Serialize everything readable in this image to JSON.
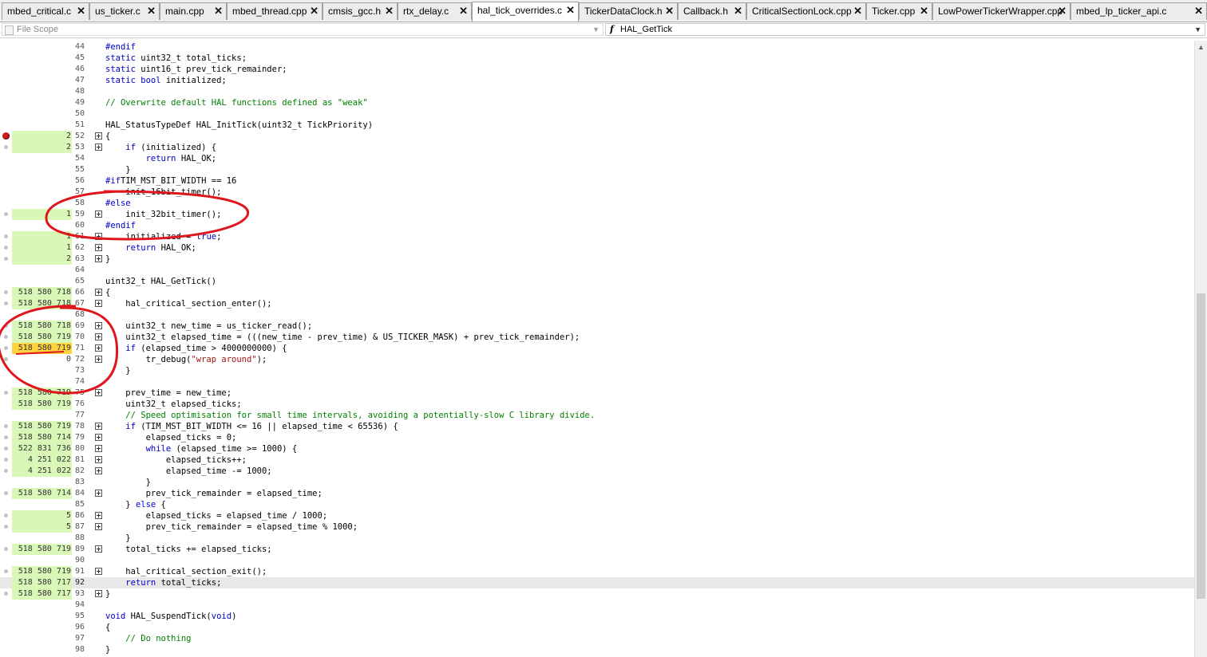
{
  "tabs": [
    {
      "label": "mbed_critical.c",
      "active": false
    },
    {
      "label": "us_ticker.c",
      "active": false
    },
    {
      "label": "main.cpp",
      "active": false
    },
    {
      "label": "mbed_thread.cpp",
      "active": false
    },
    {
      "label": "cmsis_gcc.h",
      "active": false
    },
    {
      "label": "rtx_delay.c",
      "active": false
    },
    {
      "label": "hal_tick_overrides.c",
      "active": true
    },
    {
      "label": "TickerDataClock.h",
      "active": false
    },
    {
      "label": "Callback.h",
      "active": false
    },
    {
      "label": "CriticalSectionLock.cpp",
      "active": false
    },
    {
      "label": "Ticker.cpp",
      "active": false
    },
    {
      "label": "LowPowerTickerWrapper.cpp",
      "active": false
    },
    {
      "label": "mbed_lp_ticker_api.c",
      "active": false
    }
  ],
  "tab_close_glyph": "✕",
  "navigation": {
    "scope_label": "File Scope",
    "function_icon": "f",
    "function_label": "HAL_GetTick",
    "dropdown_glyph": "▼"
  },
  "colors": {
    "coverage_hit": "#d9f7b7",
    "coverage_hot": "#ffd23f",
    "breakpoint": "#d21e1e",
    "annotation": "#e0161e",
    "keyword": "#0000cc",
    "comment": "#008000"
  },
  "lines": [
    {
      "n": "44",
      "hits": "",
      "cov": false,
      "bp": "",
      "fold": false,
      "code": [
        [
          "pp",
          "#endif"
        ]
      ]
    },
    {
      "n": "45",
      "hits": "",
      "cov": false,
      "bp": "",
      "fold": false,
      "code": [
        [
          "kw",
          "static"
        ],
        [
          "",
          "uint32_t total_ticks;"
        ]
      ]
    },
    {
      "n": "46",
      "hits": "",
      "cov": false,
      "bp": "",
      "fold": false,
      "code": [
        [
          "kw",
          "static"
        ],
        [
          "",
          "uint16_t prev_tick_remainder;"
        ]
      ]
    },
    {
      "n": "47",
      "hits": "",
      "cov": false,
      "bp": "",
      "fold": false,
      "code": [
        [
          "kw",
          "static"
        ],
        [
          "",
          ""
        ],
        [
          "kw",
          "bool"
        ],
        [
          "",
          "initialized;"
        ]
      ]
    },
    {
      "n": "48",
      "hits": "",
      "cov": false,
      "bp": "",
      "fold": false,
      "code": []
    },
    {
      "n": "49",
      "hits": "",
      "cov": false,
      "bp": "",
      "fold": false,
      "code": [
        [
          "cm",
          "// Overwrite default HAL functions defined as \"weak\""
        ]
      ]
    },
    {
      "n": "50",
      "hits": "",
      "cov": false,
      "bp": "",
      "fold": false,
      "code": []
    },
    {
      "n": "51",
      "hits": "",
      "cov": false,
      "bp": "",
      "fold": false,
      "code": [
        [
          "",
          "HAL_StatusTypeDef HAL_InitTick(uint32_t TickPriority)"
        ]
      ]
    },
    {
      "n": "52",
      "hits": "2",
      "cov": true,
      "bp": "red",
      "fold": true,
      "code": [
        [
          "",
          "{"
        ]
      ]
    },
    {
      "n": "53",
      "hits": "2",
      "cov": true,
      "bp": "dot",
      "fold": true,
      "code": [
        [
          "",
          "    "
        ],
        [
          "kw",
          "if"
        ],
        [
          "",
          "(initialized) {"
        ]
      ]
    },
    {
      "n": "54",
      "hits": "",
      "cov": false,
      "bp": "",
      "fold": false,
      "code": [
        [
          "",
          "        "
        ],
        [
          "kw",
          "return"
        ],
        [
          "",
          "HAL_OK;"
        ]
      ]
    },
    {
      "n": "55",
      "hits": "",
      "cov": false,
      "bp": "",
      "fold": false,
      "code": [
        [
          "",
          "    }"
        ]
      ]
    },
    {
      "n": "56",
      "hits": "",
      "cov": false,
      "bp": "",
      "fold": false,
      "code": [
        [
          "pp",
          "#if"
        ],
        [
          "",
          "TIM_MST_BIT_WIDTH == 16"
        ]
      ]
    },
    {
      "n": "57",
      "hits": "",
      "cov": false,
      "bp": "",
      "fold": false,
      "code": [
        [
          "",
          "    init_16bit_timer();"
        ]
      ]
    },
    {
      "n": "58",
      "hits": "",
      "cov": false,
      "bp": "",
      "fold": false,
      "code": [
        [
          "pp",
          "#else"
        ]
      ]
    },
    {
      "n": "59",
      "hits": "1",
      "cov": true,
      "bp": "dot",
      "fold": true,
      "code": [
        [
          "",
          "    init_32bit_timer();"
        ]
      ]
    },
    {
      "n": "60",
      "hits": "",
      "cov": false,
      "bp": "",
      "fold": false,
      "code": [
        [
          "pp",
          "#endif"
        ]
      ]
    },
    {
      "n": "61",
      "hits": "1",
      "cov": true,
      "bp": "dot",
      "fold": true,
      "code": [
        [
          "",
          "    initialized = "
        ],
        [
          "kw",
          "true"
        ],
        [
          "",
          ";"
        ]
      ]
    },
    {
      "n": "62",
      "hits": "1",
      "cov": true,
      "bp": "dot",
      "fold": true,
      "code": [
        [
          "",
          "    "
        ],
        [
          "kw",
          "return"
        ],
        [
          "",
          "HAL_OK;"
        ]
      ]
    },
    {
      "n": "63",
      "hits": "2",
      "cov": true,
      "bp": "dot",
      "fold": true,
      "code": [
        [
          "",
          "}"
        ]
      ]
    },
    {
      "n": "64",
      "hits": "",
      "cov": false,
      "bp": "",
      "fold": false,
      "code": []
    },
    {
      "n": "65",
      "hits": "",
      "cov": false,
      "bp": "",
      "fold": false,
      "code": [
        [
          "",
          "uint32_t HAL_GetTick()"
        ]
      ]
    },
    {
      "n": "66",
      "hits": "518 580 718",
      "cov": true,
      "bp": "dot",
      "fold": true,
      "code": [
        [
          "",
          "{"
        ]
      ]
    },
    {
      "n": "67",
      "hits": "518 580 718",
      "cov": true,
      "bp": "dot",
      "fold": true,
      "code": [
        [
          "",
          "    hal_critical_section_enter();"
        ]
      ]
    },
    {
      "n": "68",
      "hits": "",
      "cov": false,
      "bp": "",
      "fold": false,
      "code": []
    },
    {
      "n": "69",
      "hits": "518 580 718",
      "cov": true,
      "bp": "dot",
      "fold": true,
      "code": [
        [
          "",
          "    uint32_t new_time = us_ticker_read();"
        ]
      ]
    },
    {
      "n": "70",
      "hits": "518 580 719",
      "cov": true,
      "bp": "dot",
      "fold": true,
      "code": [
        [
          "",
          "    uint32_t elapsed_time = (((new_time - prev_time) & US_TICKER_MASK) + prev_tick_remainder);"
        ]
      ]
    },
    {
      "n": "71",
      "hits": "518 580 719",
      "cov": "hot",
      "bp": "dot",
      "fold": true,
      "code": [
        [
          "",
          "    "
        ],
        [
          "kw",
          "if"
        ],
        [
          "",
          "(elapsed_time > 4000000000) {"
        ]
      ]
    },
    {
      "n": "72",
      "hits": "0",
      "cov": false,
      "bp": "dot",
      "fold": true,
      "code": [
        [
          "",
          "        tr_debug("
        ],
        [
          "st",
          "\"wrap around\""
        ],
        [
          "",
          ");"
        ]
      ]
    },
    {
      "n": "73",
      "hits": "",
      "cov": false,
      "bp": "",
      "fold": false,
      "code": [
        [
          "",
          "    }"
        ]
      ]
    },
    {
      "n": "74",
      "hits": "",
      "cov": false,
      "bp": "",
      "fold": false,
      "code": []
    },
    {
      "n": "75",
      "hits": "518 580 719",
      "cov": true,
      "bp": "dot",
      "fold": true,
      "code": [
        [
          "",
          "    prev_time = new_time;"
        ]
      ]
    },
    {
      "n": "76",
      "hits": "518 580 719",
      "cov": true,
      "bp": "",
      "fold": false,
      "code": [
        [
          "",
          "    uint32_t elapsed_ticks;"
        ]
      ]
    },
    {
      "n": "77",
      "hits": "",
      "cov": false,
      "bp": "",
      "fold": false,
      "code": [
        [
          "cm",
          "    // Speed optimisation for small time intervals, avoiding a potentially-slow C library divide."
        ]
      ]
    },
    {
      "n": "78",
      "hits": "518 580 719",
      "cov": true,
      "bp": "dot",
      "fold": true,
      "code": [
        [
          "",
          "    "
        ],
        [
          "kw",
          "if"
        ],
        [
          "",
          "(TIM_MST_BIT_WIDTH <= 16 || elapsed_time < 65536) {"
        ]
      ]
    },
    {
      "n": "79",
      "hits": "518 580 714",
      "cov": true,
      "bp": "dot",
      "fold": true,
      "code": [
        [
          "",
          "        elapsed_ticks = 0;"
        ]
      ]
    },
    {
      "n": "80",
      "hits": "522 831 736",
      "cov": true,
      "bp": "dot",
      "fold": true,
      "code": [
        [
          "",
          "        "
        ],
        [
          "kw",
          "while"
        ],
        [
          "",
          "(elapsed_time >= 1000) {"
        ]
      ]
    },
    {
      "n": "81",
      "hits": "4 251 022",
      "cov": true,
      "bp": "dot",
      "fold": true,
      "code": [
        [
          "",
          "            elapsed_ticks++;"
        ]
      ]
    },
    {
      "n": "82",
      "hits": "4 251 022",
      "cov": true,
      "bp": "dot",
      "fold": true,
      "code": [
        [
          "",
          "            elapsed_time -= 1000;"
        ]
      ]
    },
    {
      "n": "83",
      "hits": "",
      "cov": false,
      "bp": "",
      "fold": false,
      "code": [
        [
          "",
          "        }"
        ]
      ]
    },
    {
      "n": "84",
      "hits": "518 580 714",
      "cov": true,
      "bp": "dot",
      "fold": true,
      "code": [
        [
          "",
          "        prev_tick_remainder = elapsed_time;"
        ]
      ]
    },
    {
      "n": "85",
      "hits": "",
      "cov": false,
      "bp": "",
      "fold": false,
      "code": [
        [
          "",
          "    } "
        ],
        [
          "kw",
          "else"
        ],
        [
          "",
          "{"
        ]
      ]
    },
    {
      "n": "86",
      "hits": "5",
      "cov": true,
      "bp": "dot",
      "fold": true,
      "code": [
        [
          "",
          "        elapsed_ticks = elapsed_time / 1000;"
        ]
      ]
    },
    {
      "n": "87",
      "hits": "5",
      "cov": true,
      "bp": "dot",
      "fold": true,
      "code": [
        [
          "",
          "        prev_tick_remainder = elapsed_time % 1000;"
        ]
      ]
    },
    {
      "n": "88",
      "hits": "",
      "cov": false,
      "bp": "",
      "fold": false,
      "code": [
        [
          "",
          "    }"
        ]
      ]
    },
    {
      "n": "89",
      "hits": "518 580 719",
      "cov": true,
      "bp": "dot",
      "fold": true,
      "code": [
        [
          "",
          "    total_ticks += elapsed_ticks;"
        ]
      ]
    },
    {
      "n": "90",
      "hits": "",
      "cov": false,
      "bp": "",
      "fold": false,
      "code": []
    },
    {
      "n": "91",
      "hits": "518 580 719",
      "cov": true,
      "bp": "dot",
      "fold": true,
      "code": [
        [
          "",
          "    hal_critical_section_exit();"
        ]
      ]
    },
    {
      "n": "92",
      "hits": "518 580 717",
      "cov": true,
      "bp": "",
      "fold": false,
      "current": true,
      "code": [
        [
          "",
          "    "
        ],
        [
          "kw",
          "return"
        ],
        [
          "",
          "total_ticks;"
        ]
      ]
    },
    {
      "n": "93",
      "hits": "518 580 717",
      "cov": true,
      "bp": "dot",
      "fold": true,
      "code": [
        [
          "",
          "}"
        ]
      ]
    },
    {
      "n": "94",
      "hits": "",
      "cov": false,
      "bp": "",
      "fold": false,
      "code": []
    },
    {
      "n": "95",
      "hits": "",
      "cov": false,
      "bp": "",
      "fold": false,
      "code": [
        [
          "kw",
          "void"
        ],
        [
          "",
          "HAL_SuspendTick("
        ],
        [
          "kw",
          "void"
        ],
        [
          "",
          ")"
        ]
      ]
    },
    {
      "n": "96",
      "hits": "",
      "cov": false,
      "bp": "",
      "fold": false,
      "code": [
        [
          "",
          "{"
        ]
      ]
    },
    {
      "n": "97",
      "hits": "",
      "cov": false,
      "bp": "",
      "fold": false,
      "code": [
        [
          "cm",
          "    // Do nothing"
        ]
      ]
    },
    {
      "n": "98",
      "hits": "",
      "cov": false,
      "bp": "",
      "fold": false,
      "code": [
        [
          "",
          "}"
        ]
      ]
    }
  ]
}
